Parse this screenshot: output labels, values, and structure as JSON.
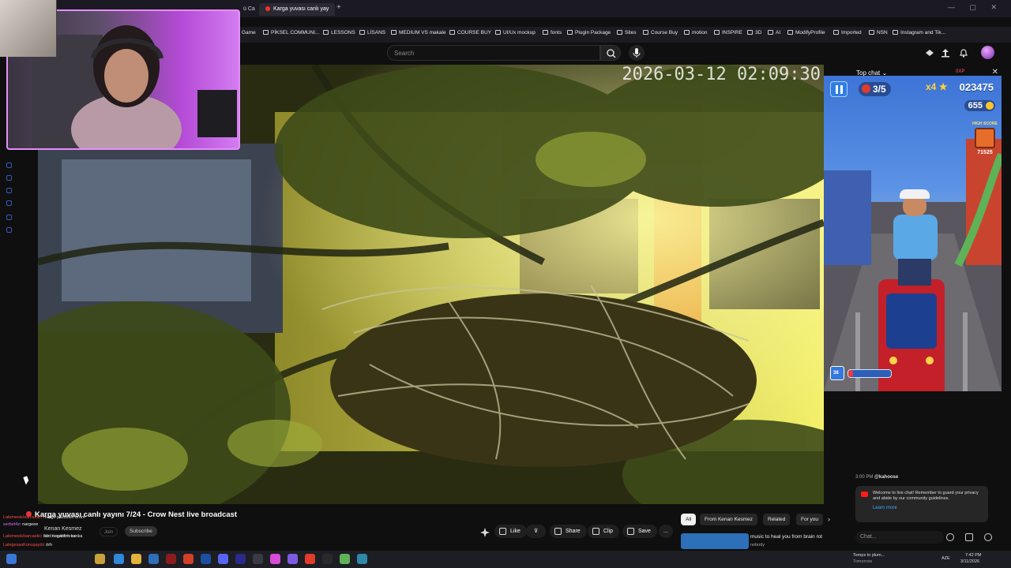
{
  "browser": {
    "tabs": [
      {
        "label": "ü Ca"
      },
      {
        "label": "Karga yuvası canlı yay"
      }
    ],
    "new_tab": "+",
    "bookmarks": [
      "Game",
      "PİKSEL COMMUNI...",
      "LESSONS",
      "LİSANS",
      "MEDIUM VS makale",
      "COURSE BUY",
      "UI/Ux mockup",
      "fonts",
      "Plugin Package",
      "Sites",
      "Course Buy",
      "motion",
      "INSPIRE",
      "3D",
      "AI",
      "ModifyProfile",
      "Imported",
      "NSN",
      "Instagram and Tik..."
    ]
  },
  "youtube": {
    "search_placeholder": "Search",
    "notifications_icon": "bell-icon",
    "upload_icon": "upload-icon"
  },
  "video": {
    "timestamp_overlay": "2026-03-12 02:09:30",
    "title": "Karga yuvası canlı yayını 7/24 - Crow Nest live broadcast",
    "channel": "Kenan Kesmez",
    "subscribers": "50.5K subscribers",
    "join_label": "Join",
    "subscribe_label": "Subscribe",
    "actions": {
      "like": "Like",
      "share": "Share",
      "clip": "Clip",
      "save": "Save",
      "more": "..."
    }
  },
  "game_overlay": {
    "lives": "3/5",
    "multiplier": "x4",
    "score": "023475",
    "coins": "655",
    "high_score_label": "HIGH SCORE",
    "high_score_value": "71525",
    "power_level": "38",
    "power_fill": 0.12
  },
  "chat": {
    "header": "Top chat",
    "viewer_badge": "0XP",
    "message_time": "3:00 PM",
    "message_user": "@kahoose",
    "notice": "Welcome to live chat! Remember to guard your privacy and abide by our community guidelines.",
    "learn_more": "Learn more",
    "input_placeholder": "Chat..."
  },
  "ticker": [
    {
      "user": "Lalemesis/sarcastic",
      "text": "marge pozitifsin brom"
    },
    {
      "user": "serbet4z",
      "text": "nargeee"
    },
    {
      "user": "Lalemesis/sarcastic",
      "text": "ben negatifim kanka"
    },
    {
      "user": "LalegesasKonuşaydı",
      "text": "örh"
    }
  ],
  "filters": [
    "All",
    "From Kenan Kesmez",
    "Related",
    "For you"
  ],
  "recommendation": {
    "title": "music to heal you from brain rot",
    "channel": "nobody"
  },
  "taskbar": {
    "weather": "Temps to plum...",
    "weather_sub": "Tomorrow",
    "lang": "AZE",
    "time": "7:42 PM",
    "date": "3/11/2026"
  }
}
